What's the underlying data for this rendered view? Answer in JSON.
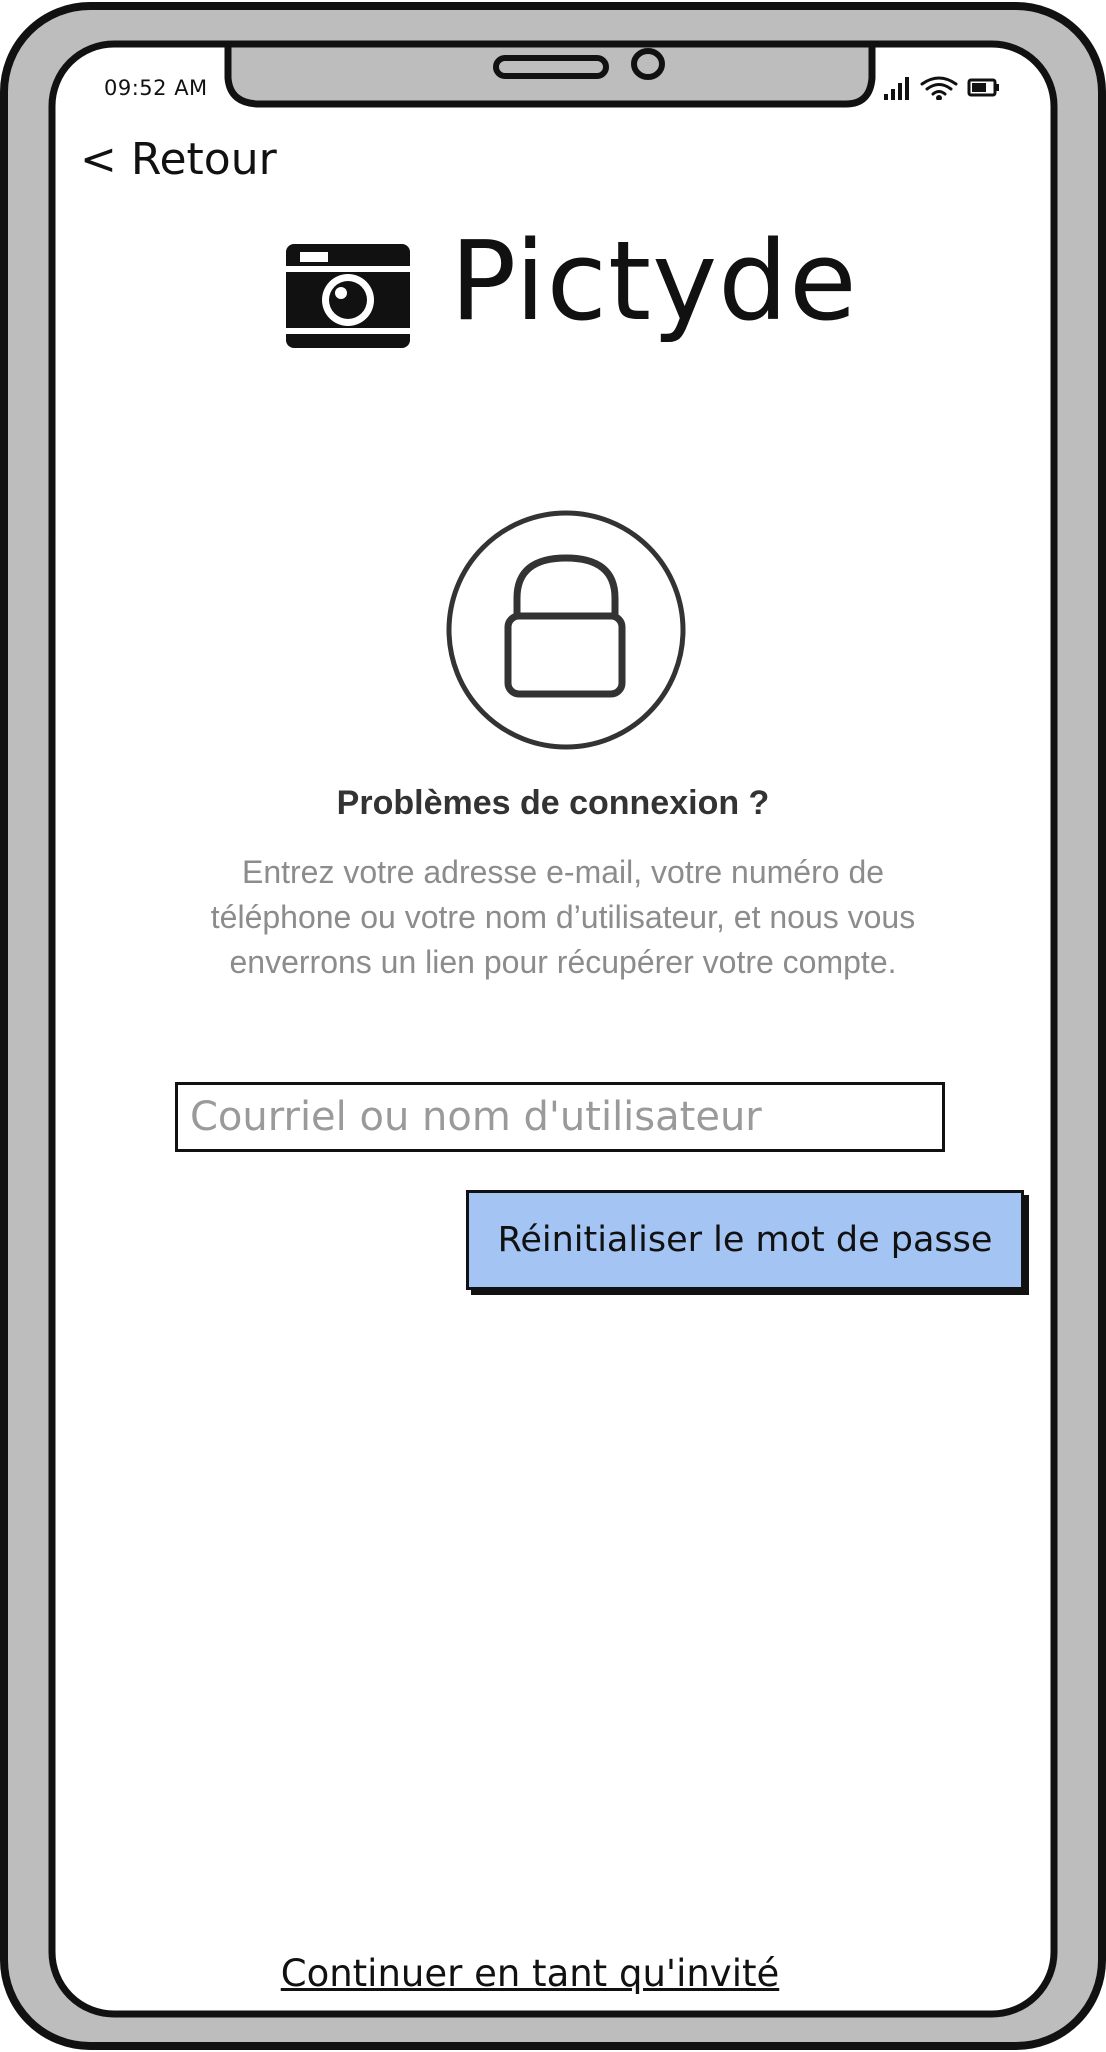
{
  "status_bar": {
    "time": "09:52 AM"
  },
  "nav": {
    "back_label": "< Retour"
  },
  "logo": {
    "text": "Pictyde",
    "icon": "camera-icon"
  },
  "lock": {
    "icon": "lock-icon"
  },
  "heading": "Problèmes de connexion ?",
  "description": "Entrez votre adresse e-mail, votre numéro de téléphone ou votre nom d’utilisateur, et nous vous enverrons un lien pour récupérer votre compte.",
  "form": {
    "input_placeholder": "Courriel ou nom d'utilisateur",
    "input_value": "",
    "submit_label": "Réinitialiser le mot de passe"
  },
  "footer": {
    "guest_label": "Continuer en tant qu'invité"
  },
  "colors": {
    "button_fill": "#a4c4f4",
    "frame_gray": "#bdbdbd"
  }
}
